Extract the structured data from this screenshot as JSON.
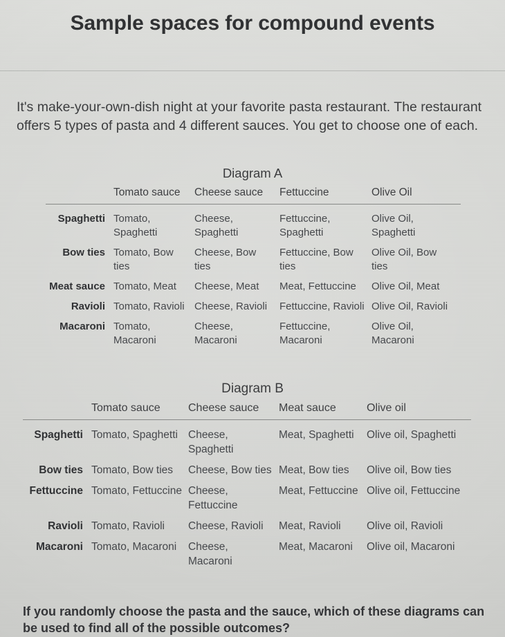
{
  "header": {
    "title": "Sample spaces for compound events"
  },
  "intro": {
    "text": "It's make-your-own-dish night at your favorite pasta restaurant. The restaurant offers 5 types of pasta and 4 different sauces. You get to choose one of each."
  },
  "diagram_a": {
    "title": "Diagram A",
    "corner_label": "",
    "columns": [
      "Tomato sauce",
      "Cheese sauce",
      "Fettuccine",
      "Olive Oil"
    ],
    "rows": [
      {
        "label": "Spaghetti",
        "cells": [
          "Tomato, Spaghetti",
          "Cheese, Spaghetti",
          "Fettuccine, Spaghetti",
          "Olive Oil, Spaghetti"
        ]
      },
      {
        "label": "Bow ties",
        "cells": [
          "Tomato, Bow ties",
          "Cheese, Bow ties",
          "Fettuccine, Bow ties",
          "Olive Oil, Bow ties"
        ]
      },
      {
        "label": "Meat sauce",
        "cells": [
          "Tomato, Meat",
          "Cheese, Meat",
          "Meat, Fettuccine",
          "Olive Oil, Meat"
        ]
      },
      {
        "label": "Ravioli",
        "cells": [
          "Tomato, Ravioli",
          "Cheese, Ravioli",
          "Fettuccine, Ravioli",
          "Olive Oil, Ravioli"
        ]
      },
      {
        "label": "Macaroni",
        "cells": [
          "Tomato, Macaroni",
          "Cheese, Macaroni",
          "Fettuccine, Macaroni",
          "Olive Oil, Macaroni"
        ]
      }
    ]
  },
  "diagram_b": {
    "title": "Diagram B",
    "corner_label": "",
    "columns": [
      "Tomato sauce",
      "Cheese sauce",
      "Meat sauce",
      "Olive oil"
    ],
    "rows": [
      {
        "label": "Spaghetti",
        "cells": [
          "Tomato, Spaghetti",
          "Cheese, Spaghetti",
          "Meat, Spaghetti",
          "Olive oil, Spaghetti"
        ]
      },
      {
        "label": "Bow ties",
        "cells": [
          "Tomato, Bow ties",
          "Cheese, Bow ties",
          "Meat, Bow ties",
          "Olive oil, Bow ties"
        ]
      },
      {
        "label": "Fettuccine",
        "cells": [
          "Tomato, Fettuccine",
          "Cheese, Fettuccine",
          "Meat, Fettuccine",
          "Olive oil, Fettuccine"
        ]
      },
      {
        "label": "Ravioli",
        "cells": [
          "Tomato, Ravioli",
          "Cheese, Ravioli",
          "Meat, Ravioli",
          "Olive oil, Ravioli"
        ]
      },
      {
        "label": "Macaroni",
        "cells": [
          "Tomato, Macaroni",
          "Cheese, Macaroni",
          "Meat, Macaroni",
          "Olive oil, Macaroni"
        ]
      }
    ]
  },
  "question": {
    "text": "If you randomly choose the pasta and the sauce, which of these diagrams can be used to find all of the possible outcomes?"
  },
  "colors": {
    "background": "#d6d7d4",
    "text": "#3a3a3c",
    "title": "#2f3032",
    "rule": "#787a78"
  }
}
